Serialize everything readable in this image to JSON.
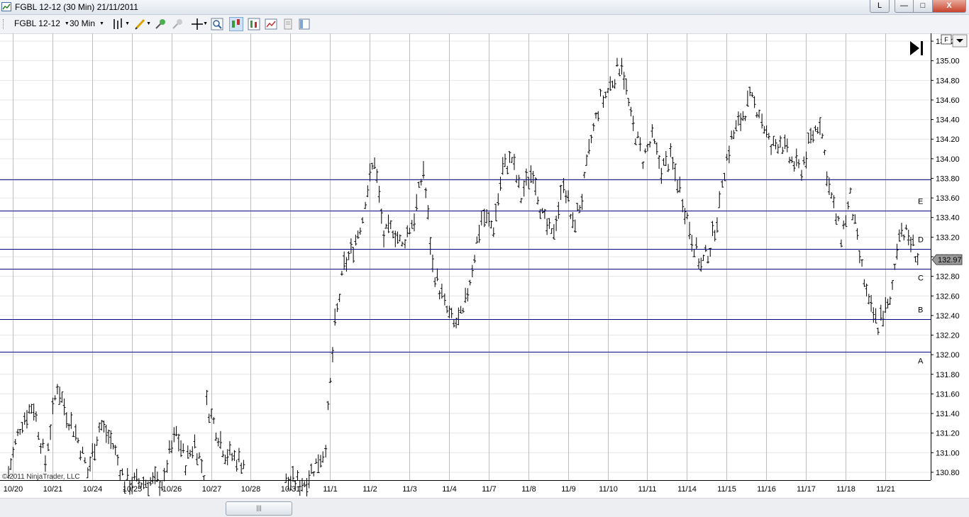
{
  "window": {
    "title": "FGBL 12-12 (30 Min)  21/11/2011",
    "btn_l": "L",
    "btn_min": "—",
    "btn_max": "□",
    "btn_close": "X"
  },
  "toolbar": {
    "instrument": "FGBL 12-12",
    "interval": "30 Min",
    "icons": [
      "bar-type-icon",
      "drawing-tool-icon",
      "pin-icon",
      "pin-inactive-icon",
      "crosshair-icon",
      "zoom-icon",
      "chart-trader-icon",
      "data-box-icon",
      "chart-style-icon",
      "properties-icon",
      "panels-icon"
    ]
  },
  "chart_panel": {
    "f_button": "F",
    "copyright": "© 2011 NinjaTrader, LLC"
  },
  "colors": {
    "bars": "#000000",
    "level_lines": "#00007f",
    "grid": "#c0c0c0",
    "background": "#ffffff"
  },
  "chart_data": {
    "type": "bar",
    "title": "FGBL 12-12 (30 Min)",
    "ylim": [
      130.72,
      135.28
    ],
    "y_ticks": [
      130.8,
      131.0,
      131.2,
      131.4,
      131.6,
      131.8,
      132.0,
      132.2,
      132.4,
      132.6,
      132.8,
      133.0,
      133.2,
      133.4,
      133.6,
      133.8,
      134.0,
      134.2,
      134.4,
      134.6,
      134.8,
      135.0,
      135.2
    ],
    "y_tick_labels": [
      "130.80",
      "131.00",
      "131.20",
      "131.40",
      "131.60",
      "131.80",
      "132.00",
      "132.20",
      "132.40",
      "132.60",
      "132.80",
      "133.00",
      "133.20",
      "133.40",
      "133.60",
      "133.80",
      "134.00",
      "134.20",
      "134.40",
      "134.60",
      "134.80",
      "135.00",
      "135.20"
    ],
    "dates": [
      "10/20",
      "10/21",
      "10/24",
      "10/25",
      "10/26",
      "10/27",
      "10/28",
      "10/31",
      "11/1",
      "11/2",
      "11/3",
      "11/4",
      "11/7",
      "11/8",
      "11/9",
      "11/10",
      "11/11",
      "11/14",
      "11/15",
      "11/16",
      "11/17",
      "11/18",
      "11/21"
    ],
    "current_price": 132.97,
    "current_price_label": "132.97",
    "levels": [
      {
        "label": "",
        "value": 133.79
      },
      {
        "label": "E",
        "value": 133.47
      },
      {
        "label": "D",
        "value": 133.08
      },
      {
        "label": "C",
        "value": 132.88
      },
      {
        "label": "B",
        "value": 132.36
      },
      {
        "label": "A",
        "value": 132.03
      }
    ],
    "daily_path": [
      {
        "date": "10/20",
        "points": [
          130.8,
          131.3,
          131.5,
          130.9
        ]
      },
      {
        "date": "10/21",
        "points": [
          131.1,
          131.7,
          131.4,
          131.2,
          130.9
        ]
      },
      {
        "date": "10/24",
        "points": [
          130.8,
          131.3,
          131.1,
          130.7
        ]
      },
      {
        "date": "10/25",
        "points": [
          130.7,
          130.7
        ]
      },
      {
        "date": "10/26",
        "points": [
          130.9,
          131.2,
          130.9,
          131.1,
          130.8
        ]
      },
      {
        "date": "10/27",
        "points": [
          131.5,
          131.0,
          130.9
        ]
      },
      {
        "date": "10/31",
        "points": [
          130.7,
          130.7,
          131.0
        ]
      },
      {
        "date": "11/1",
        "points": [
          131.1,
          132.3,
          132.9,
          133.1,
          133.4
        ]
      },
      {
        "date": "11/2",
        "points": [
          133.6,
          134.0,
          133.2,
          133.3,
          133.1
        ]
      },
      {
        "date": "11/3",
        "points": [
          133.2,
          133.4,
          133.9,
          132.9,
          132.6
        ]
      },
      {
        "date": "11/4",
        "points": [
          132.5,
          132.3,
          132.4,
          132.9,
          133.4
        ]
      },
      {
        "date": "11/7",
        "points": [
          133.4,
          133.3,
          133.9,
          134.0,
          133.6
        ]
      },
      {
        "date": "11/8",
        "points": [
          133.7,
          133.9,
          133.4,
          133.2,
          133.6
        ]
      },
      {
        "date": "11/9",
        "points": [
          133.8,
          133.3,
          133.6,
          134.2,
          134.6
        ]
      },
      {
        "date": "11/10",
        "points": [
          134.6,
          134.8,
          135.0,
          134.4,
          134.1
        ]
      },
      {
        "date": "11/11",
        "points": [
          134.0,
          134.2,
          133.9,
          134.0,
          133.7
        ]
      },
      {
        "date": "11/14",
        "points": [
          133.6,
          133.2,
          132.9,
          133.1,
          133.5
        ]
      },
      {
        "date": "11/15",
        "points": [
          133.8,
          134.2,
          134.4,
          134.6,
          134.5
        ]
      },
      {
        "date": "11/16",
        "points": [
          134.4,
          134.1,
          134.2,
          134.0,
          133.9
        ]
      },
      {
        "date": "11/17",
        "points": [
          133.9,
          134.2,
          134.4,
          133.7,
          133.3
        ]
      },
      {
        "date": "11/18",
        "points": [
          133.2,
          133.6,
          133.0,
          132.5,
          132.3
        ]
      },
      {
        "date": "11/21",
        "points": [
          132.4,
          132.5,
          133.3,
          133.2,
          133.0
        ]
      }
    ]
  }
}
